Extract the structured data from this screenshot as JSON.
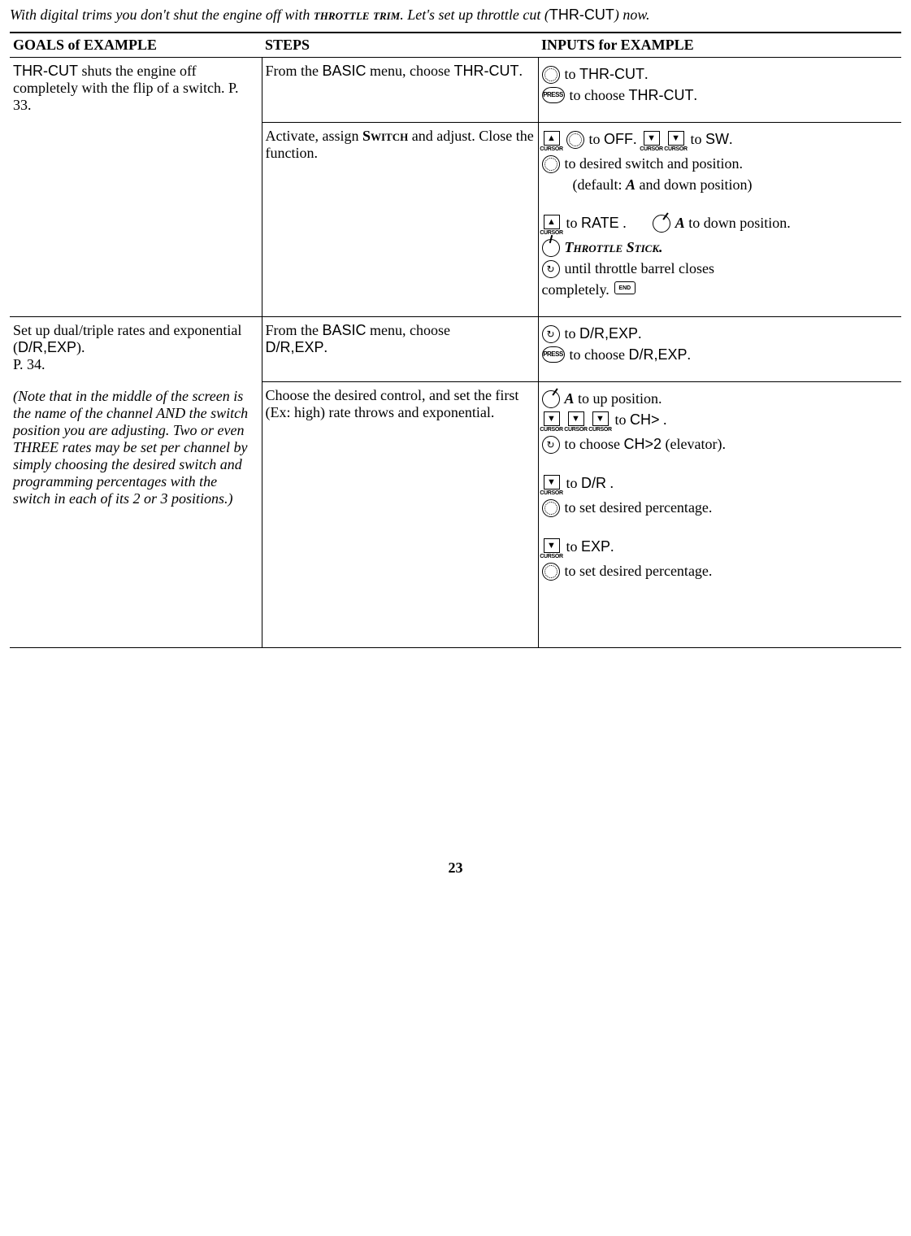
{
  "intro": {
    "pre": "With digital trims you don't shut the engine off with ",
    "sc": "throttle trim",
    "mid": ". Let's set up throttle cut (",
    "mono": "THR-CUT",
    "post": ") now."
  },
  "headers": {
    "goals": "GOALS of EXAMPLE",
    "steps": "STEPS",
    "inputs": "INPUTS for EXAMPLE"
  },
  "row1": {
    "goal_mono": "THR-CUT",
    "goal_rest": " shuts the engine off completely with the flip of a switch. P. 33.",
    "step1_a": "From the ",
    "step1_b": "BASIC",
    "step1_c": " menu, choose ",
    "step1_d": "THR-CUT",
    "step1_e": ".",
    "in1_to": " to ",
    "in1_thrcut": "THR-CUT",
    "in1_dot": ".",
    "in2_pre": " to choose ",
    "in2_thrcut": "THR-CUT",
    "in2_dot": "."
  },
  "row2": {
    "step_a": "Activate, assign ",
    "step_b": "Switch",
    "step_c": " and adjust. Close the function.",
    "line1_to": " to ",
    "line1_off": "OFF",
    "line1_dot": ".",
    "line1_to2": " to ",
    "line1_sw": "SW",
    "line1_dot2": ".",
    "line2": " to desired switch and position.",
    "line2b_pre": "(default: ",
    "line2b_a": "A",
    "line2b_post": " and down position)",
    "line3_to": " to ",
    "line3_rate": "RATE",
    "line3_dot": " .",
    "line3_a": "A",
    "line3_rest": " to down position.",
    "line4": "Throttle Stick.",
    "line5": " until throttle barrel closes",
    "line6_a": "completely. "
  },
  "row3": {
    "goal_a": "Set up dual/triple rates and exponential (",
    "goal_b": "D/R,EXP",
    "goal_c": ").",
    "goal_d": "P. 34.",
    "note": "(Note that in the middle of the screen is the name of the channel AND the switch position you are adjusting. Two or even THREE rates may be set per channel by simply choosing the desired switch and programming percentages with the switch in each of its 2 or 3 positions.)",
    "step1_a": "From the ",
    "step1_b": "BASIC",
    "step1_c": " menu, choose ",
    "step1_d": "D/R,EXP",
    "step1_e": ".",
    "in1_to": " to ",
    "in1_dr": "D/R,EXP",
    "in1_dot": ".",
    "in2_pre": " to choose ",
    "in2_dr": "D/R,EXP",
    "in2_dot": "."
  },
  "row4": {
    "step": "Choose the desired control, and set the first (Ex: high) rate throws and exponential.",
    "l1_a": "A",
    "l1_rest": " to up position.",
    "l2_to": " to ",
    "l2_ch": "CH>",
    "l2_dot": " .",
    "l3_pre": " to choose ",
    "l3_ch2": "CH>2",
    "l3_post": " (elevator).",
    "l4_to": " to ",
    "l4_dr": "D/R",
    "l4_dot": " .",
    "l5": " to set desired percentage.",
    "l6_to": " to ",
    "l6_exp": "EXP",
    "l6_dot": ".",
    "l7": " to set desired percentage."
  },
  "labels": {
    "cursor": "CURSOR",
    "press": "PRESS",
    "end": "END"
  },
  "page": "23"
}
